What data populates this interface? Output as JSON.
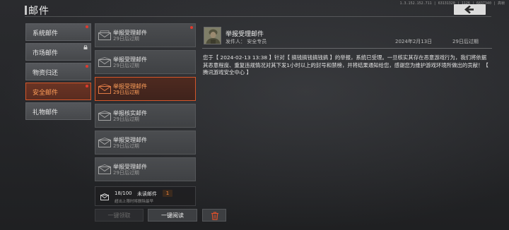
{
  "version": "1.3.152.152.711 | 63131320 | 1126 | 6837340 | 高帧",
  "header": {
    "title": "邮件",
    "back_icon": "chevron-left-icon"
  },
  "categories": [
    {
      "label": "系统邮件",
      "has_dot": true
    },
    {
      "label": "市场邮件",
      "locked": true
    },
    {
      "label": "物资归还",
      "has_dot": true
    },
    {
      "label": "安全邮件",
      "active": true,
      "has_dot": true
    },
    {
      "label": "礼物邮件"
    }
  ],
  "mails": [
    {
      "title": "举报受理邮件",
      "expire": "29日后过期",
      "unread": true
    },
    {
      "title": "举报受理邮件",
      "expire": "29日后过期"
    },
    {
      "title": "举报受理邮件",
      "expire": "29日后过期",
      "selected": true
    },
    {
      "title": "举报核实邮件",
      "expire": "29日后过期"
    },
    {
      "title": "举报受理邮件",
      "expire": "29日后过期"
    },
    {
      "title": "举报受理邮件",
      "expire": "29日后过期"
    }
  ],
  "mailbox": {
    "count": "18/100",
    "unread_label": "未读邮件",
    "unread_count": "1",
    "note": "超出上限时将删除最早"
  },
  "actions": {
    "claim_all": "一键领取",
    "read_all": "一键阅读",
    "delete_icon": "trash-icon"
  },
  "detail": {
    "title": "举报受理邮件",
    "sender": "发件人：  安全专员",
    "date": "2024年2月13日",
    "expire": "29日后过期",
    "body": "您于【 2024-02-13 13:38 】针对【 搞钱搞钱搞钱搞 】的举报，系统已受理。一旦核实其存在恶意游戏行为，我们将依据其恶意程度、重复违规情况对其下发1小时以上的封号和禁榜，并将结果通知给您，感谢您为维护游戏环境所做出的贡献！【 腾讯游戏安全中心 】"
  },
  "colors": {
    "accent": "#d4562a",
    "accent_text": "#ff9f5a",
    "unread_dot": "#e03a2e"
  }
}
